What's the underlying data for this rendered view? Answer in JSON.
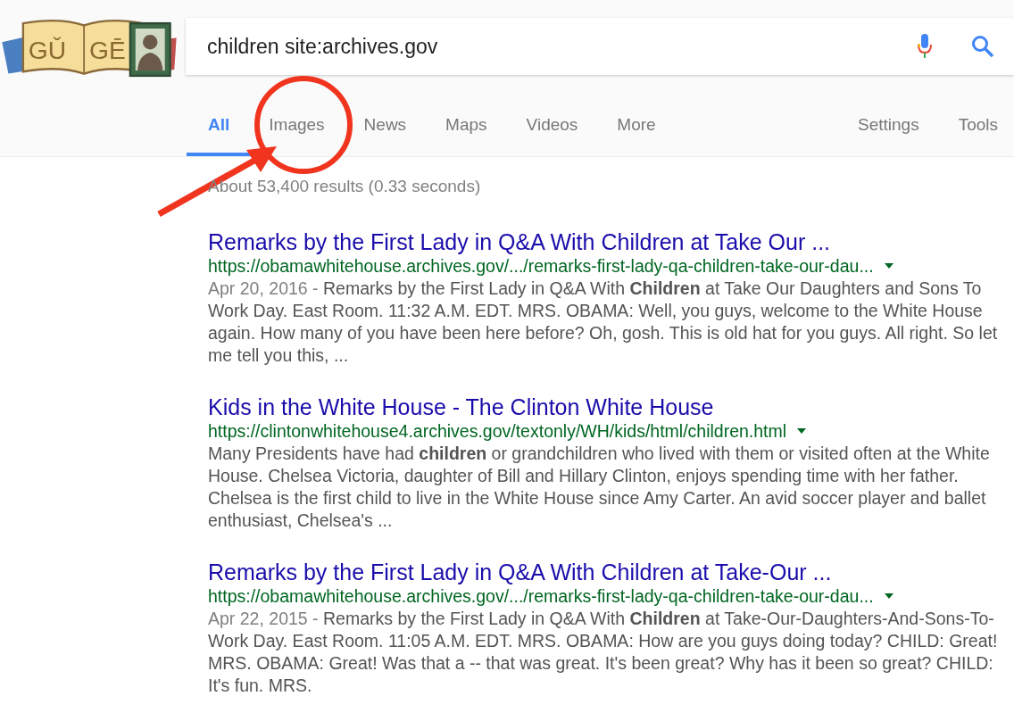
{
  "logo": {
    "letters": [
      "GǓ",
      "GĒ"
    ]
  },
  "search": {
    "value": "children site:archives.gov"
  },
  "tabs": [
    {
      "label": "All",
      "selected": true
    },
    {
      "label": "Images",
      "selected": false
    },
    {
      "label": "News",
      "selected": false
    },
    {
      "label": "Maps",
      "selected": false
    },
    {
      "label": "Videos",
      "selected": false
    },
    {
      "label": "More",
      "selected": false
    }
  ],
  "tools": [
    {
      "label": "Settings"
    },
    {
      "label": "Tools"
    }
  ],
  "result_stats": "About 53,400 results (0.33 seconds)",
  "results": [
    {
      "title": "Remarks by the First Lady in Q&A With Children at Take Our ...",
      "url": "https://obamawhitehouse.archives.gov/.../remarks-first-lady-qa-children-take-our-dau...",
      "date": "Apr 20, 2016 - ",
      "snippet": "Remarks by the First Lady in Q&A With **Children** at Take Our Daughters and Sons To Work Day. East Room. 11:32 A.M. EDT. MRS. OBAMA: Well, you guys, welcome to the White House again. How many of you have been here before? Oh, gosh. This is old hat for you guys. All right. So let me tell you this, ..."
    },
    {
      "title": "Kids in the White House - The Clinton White House",
      "url": "https://clintonwhitehouse4.archives.gov/textonly/WH/kids/html/children.html",
      "snippet": "Many Presidents have had **children** or grandchildren who lived with them or visited often at the White House. Chelsea Victoria, daughter of Bill and Hillary Clinton, enjoys spending time with her father. Chelsea is the first child to live in the White House since Amy Carter. An avid soccer player and ballet enthusiast, Chelsea's ..."
    },
    {
      "title": "Remarks by the First Lady in Q&A With Children at Take-Our ...",
      "url": "https://obamawhitehouse.archives.gov/.../remarks-first-lady-qa-children-take-our-dau...",
      "date": "Apr 22, 2015 - ",
      "snippet": "Remarks by the First Lady in Q&A With **Children** at Take-Our-Daughters-And-Sons-To-Work Day. East Room. 11:05 A.M. EDT. MRS. OBAMA: How are you guys doing today? CHILD: Great! MRS. OBAMA: Great! Was that a -- that was great. It's been great? Why has it been so great? CHILD: It's fun. MRS."
    }
  ]
}
